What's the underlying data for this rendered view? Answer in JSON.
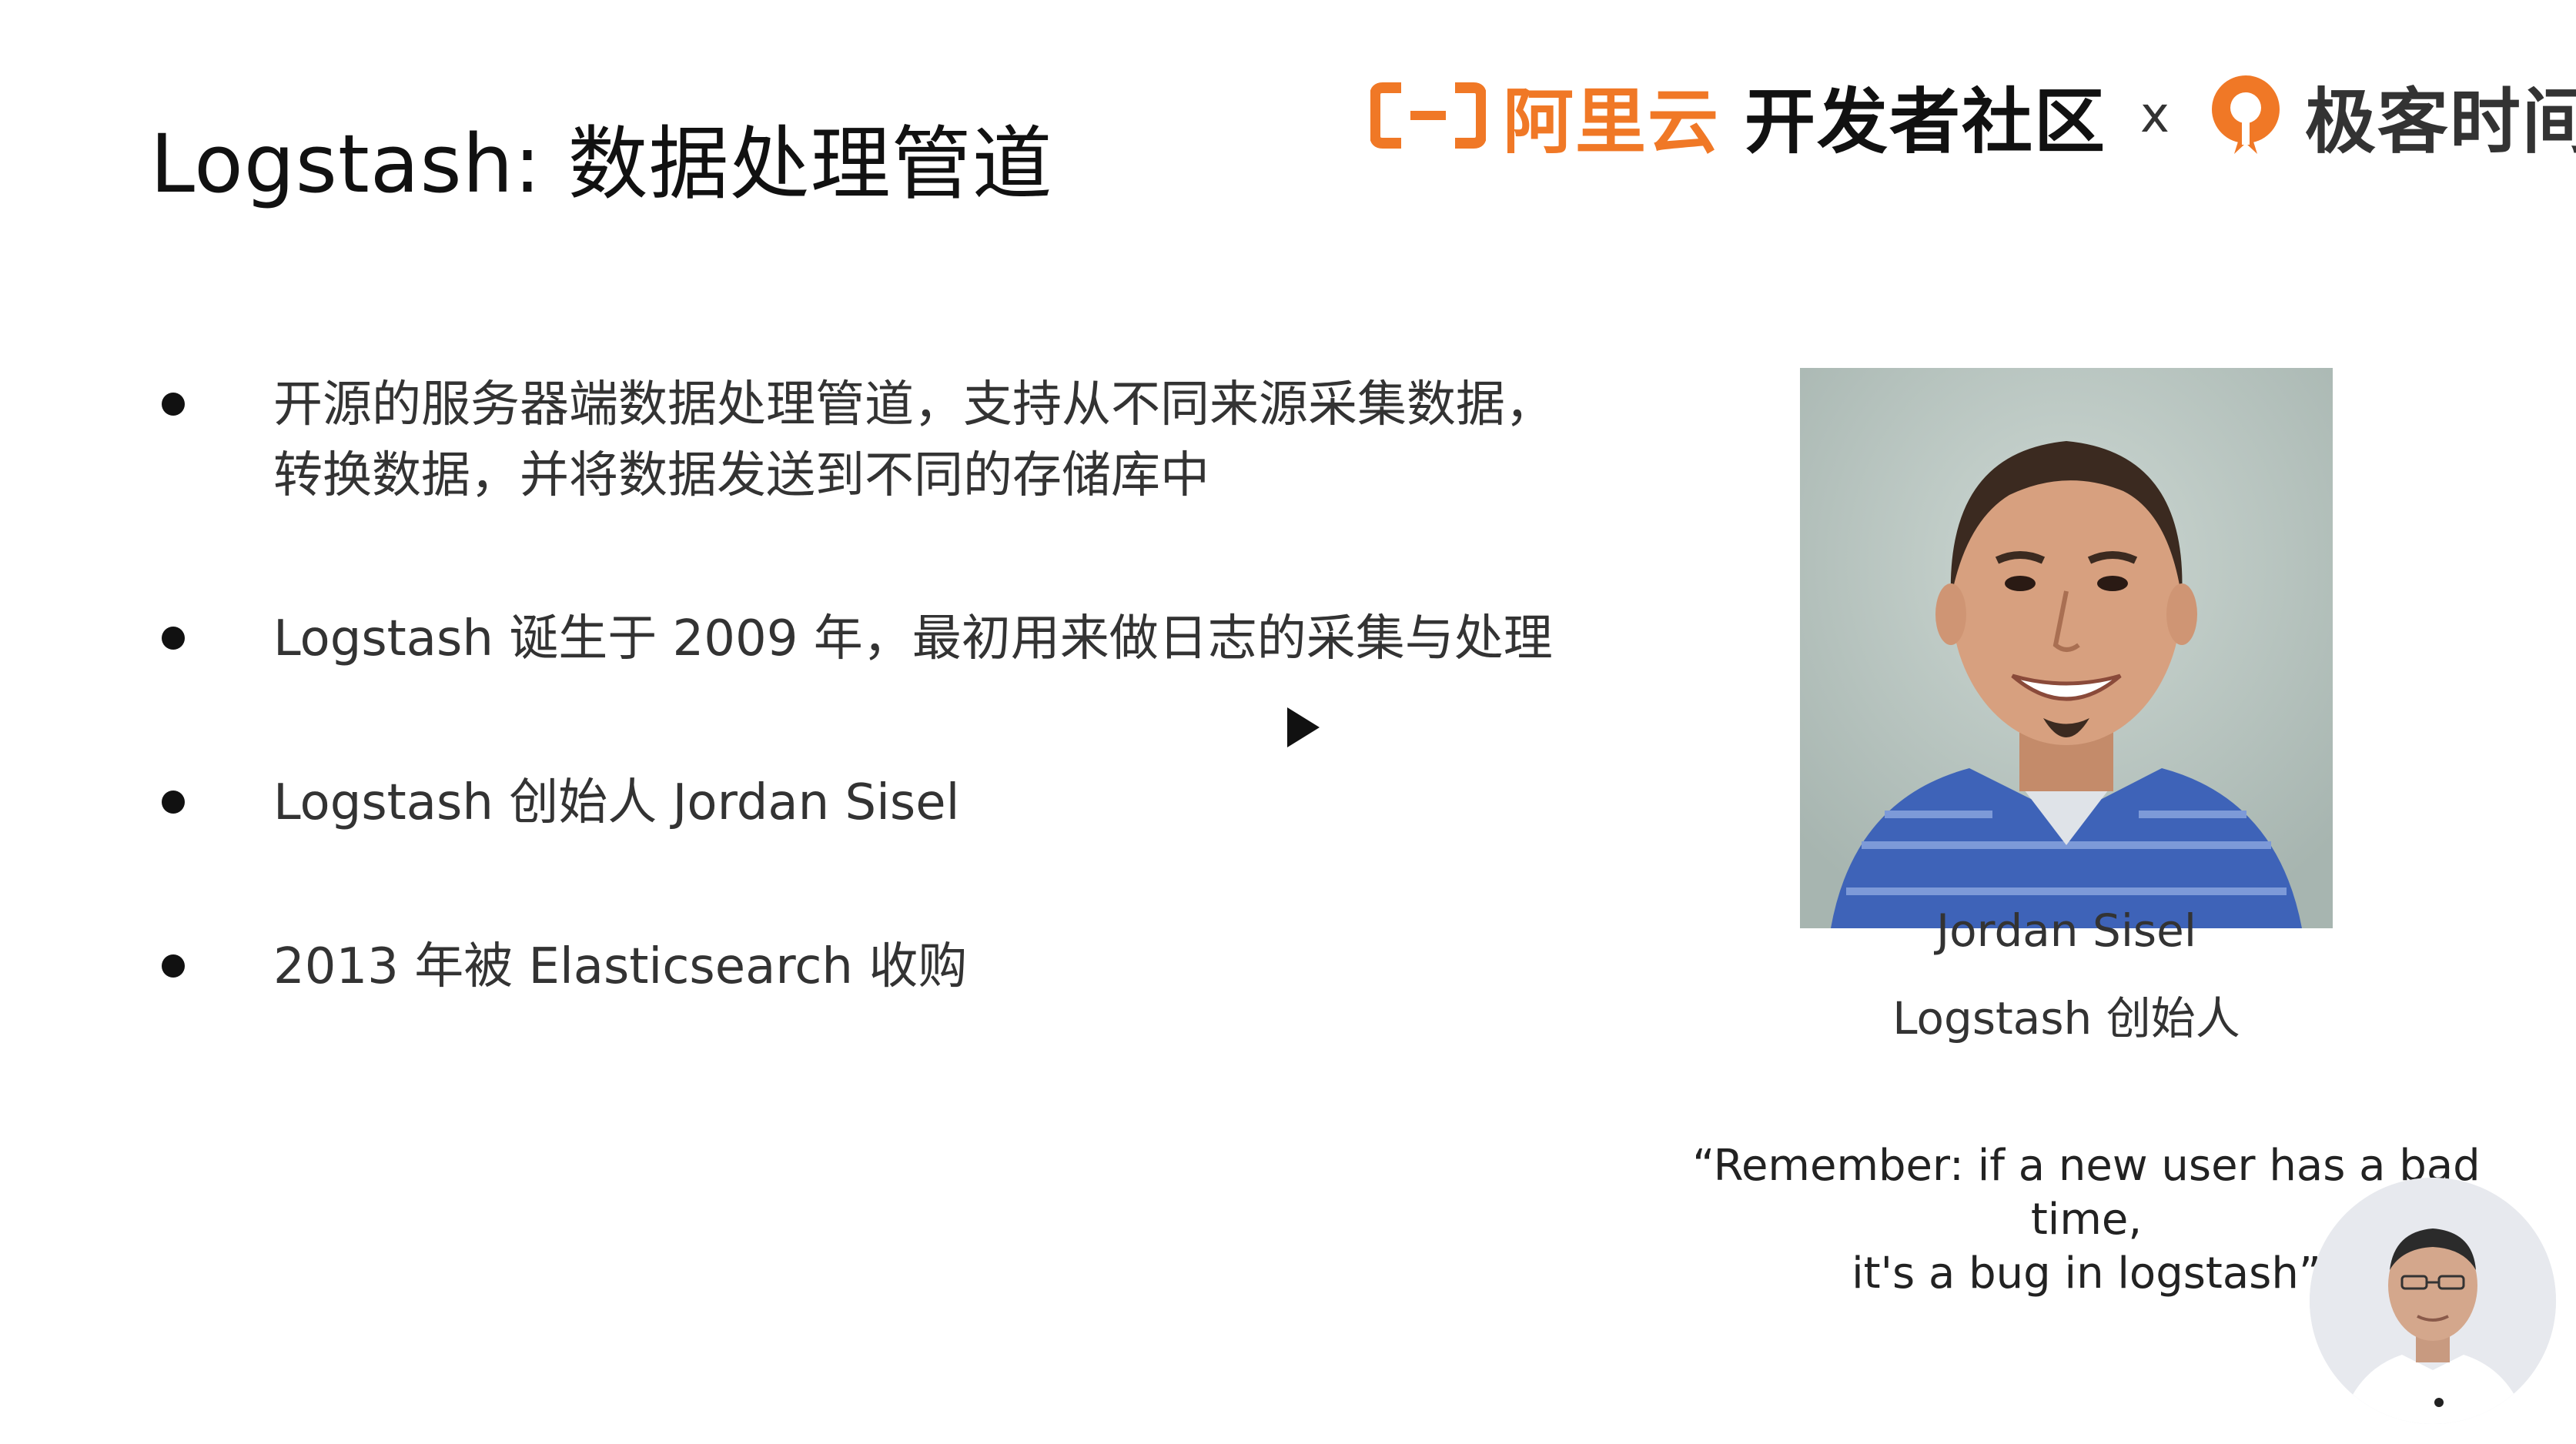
{
  "slide": {
    "title": "Logstash: 数据处理管道"
  },
  "brand": {
    "aliyun": "阿里云",
    "developer_community": "开发者社区",
    "separator": "x",
    "geektime": "极客时间",
    "aliyun_color": "#f07826",
    "geektime_color": "#f07826"
  },
  "bullets": [
    {
      "lines": [
        "开源的服务器端数据处理管道，支持从不同来源采集数据，",
        "转换数据，并将数据发送到不同的存储库中"
      ]
    },
    {
      "lines": [
        "Logstash 诞生于 2009 年，最初用来做日志的采集与处理"
      ]
    },
    {
      "lines": [
        "Logstash 创始人 Jordan Sisel"
      ]
    },
    {
      "lines": [
        "2013 年被 Elasticsearch 收购"
      ]
    }
  ],
  "portrait": {
    "name": "Jordan Sisel",
    "role": "Logstash 创始人"
  },
  "quote": {
    "line1": "“Remember: if a new user has a bad time,",
    "line2": "it's a bug in logstash”"
  },
  "icons": {
    "play": "play-icon",
    "aliyun_logo": "aliyun-logo-icon",
    "geektime_logo": "geektime-logo-icon"
  }
}
